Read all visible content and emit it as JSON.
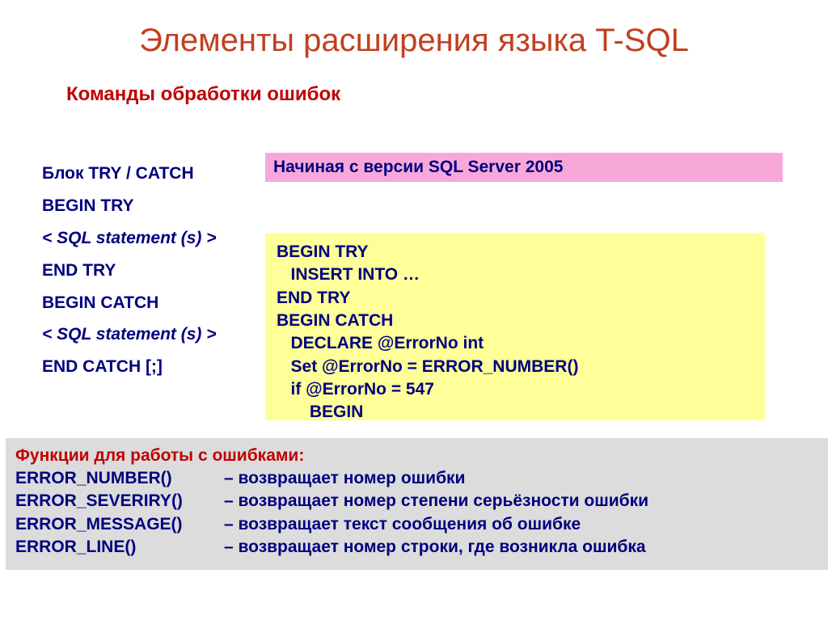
{
  "title": "Элементы расширения языка T-SQL",
  "subtitle": "Команды обработки ошибок",
  "left": {
    "l1": "Блок TRY / CATCH",
    "l2": "BEGIN TRY",
    "l3": " < SQL statement (s)  >",
    "l4": "END TRY",
    "l5": "BEGIN CATCH",
    "l6": "< SQL statement (s) >",
    "l7": " END CATCH [;]"
  },
  "pink": "Начиная с версии SQL Server 2005",
  "yellow": "BEGIN TRY\n   INSERT INTO …\nEND TRY\nBEGIN CATCH\n   DECLARE @ErrorNo int\n   Set @ErrorNo = ERROR_NUMBER()\n   if @ErrorNo = 547\n       BEGIN",
  "functions": {
    "title": "Функции для работы с ошибками:",
    "rows": [
      {
        "name": "ERROR_NUMBER()",
        "desc": "– возвращает номер ошибки"
      },
      {
        "name": "ERROR_SEVERIRY()",
        "desc": "– возвращает номер степени серьёзности ошибки"
      },
      {
        "name": "ERROR_MESSAGE()",
        "desc": "– возвращает текст сообщения об ошибке"
      },
      {
        "name": "ERROR_LINE()",
        "desc": "– возвращает номер строки, где возникла ошибка"
      }
    ]
  }
}
